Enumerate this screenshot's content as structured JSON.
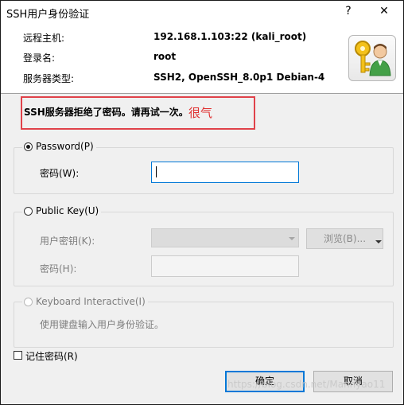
{
  "window": {
    "title": "SSH用户身份验证",
    "help_label": "?",
    "close_label": "✕"
  },
  "info": {
    "host_label": "远程主机:",
    "host_value": "192.168.1.103:22 (kali_root)",
    "login_label": "登录名:",
    "login_value": "root",
    "server_type_label": "服务器类型:",
    "server_type_value": "SSH2, OpenSSH_8.0p1 Debian-4"
  },
  "error": {
    "message": "SSH服务器拒绝了密码。请再试一次。",
    "annotation": "很气"
  },
  "password_method": {
    "label": "Password(P)",
    "selected": true,
    "password_label": "密码(W):",
    "password_value": ""
  },
  "publickey_method": {
    "label": "Public Key(U)",
    "selected": false,
    "user_key_label": "用户密钥(K):",
    "user_key_value": "",
    "browse_label": "浏览(B)...",
    "passphrase_label": "密码(H):"
  },
  "keyboard_method": {
    "label": "Keyboard Interactive(I)",
    "enabled": false,
    "description": "使用键盘输入用户身份验证。"
  },
  "remember": {
    "label": "记住密码(R)",
    "checked": false
  },
  "buttons": {
    "ok": "确定",
    "cancel": "取消"
  },
  "watermark": "https://blog.csdn.net/Mannyao11"
}
